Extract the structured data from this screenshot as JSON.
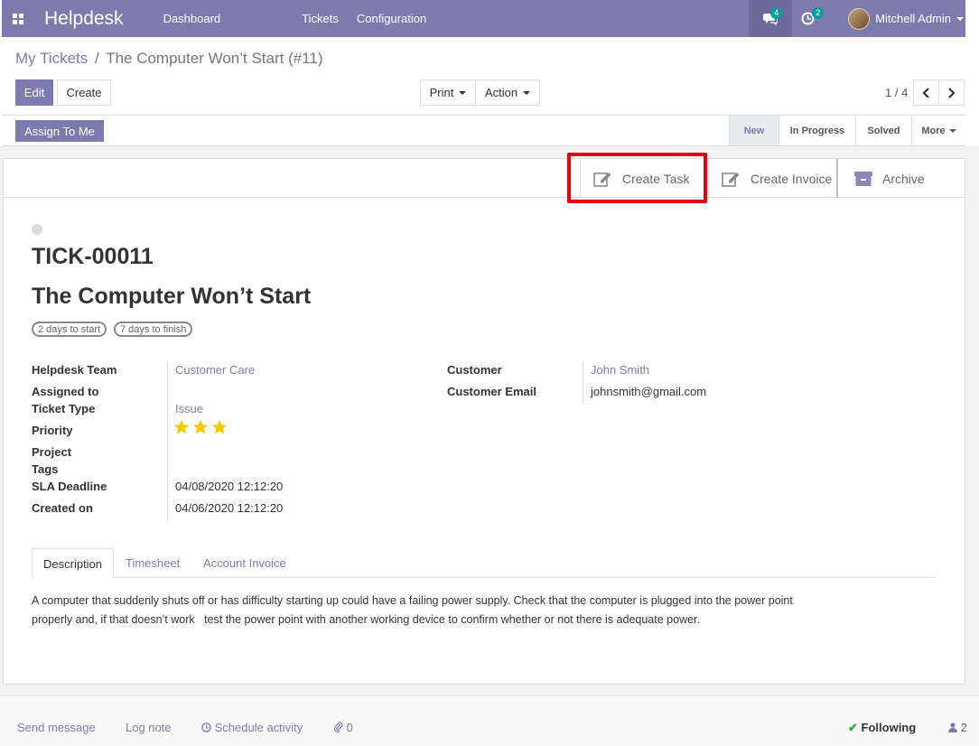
{
  "navbar": {
    "brand": "Helpdesk",
    "menu": [
      "Dashboard",
      "Tickets",
      "Configuration"
    ],
    "messages_count": "4",
    "activities_count": "2",
    "user_name": "Mitchell Admin"
  },
  "breadcrumb": {
    "parent": "My Tickets",
    "separator": "/",
    "current": "The Computer Won’t Start (#11)"
  },
  "actions": {
    "edit": "Edit",
    "create": "Create",
    "print": "Print",
    "action": "Action",
    "pager": "1 / 4"
  },
  "statusbar": {
    "assign": "Assign To Me",
    "stages": [
      "New",
      "In Progress",
      "Solved",
      "More"
    ],
    "current_stage": "New"
  },
  "smart_buttons": {
    "create_task": "Create Task",
    "create_invoice": "Create Invoice",
    "archive": "Archive"
  },
  "ticket": {
    "number": "TICK-00011",
    "title": "The Computer Won’t Start",
    "pills": [
      "2 days to start",
      "7 days to finish"
    ],
    "labels": {
      "team": "Helpdesk Team",
      "assigned": "Assigned to",
      "type": "Ticket Type",
      "priority": "Priority",
      "project": "Project",
      "tags": "Tags",
      "sla": "SLA Deadline",
      "created": "Created on",
      "customer": "Customer",
      "email": "Customer Email"
    },
    "values": {
      "team": "Customer Care",
      "type": "Issue",
      "priority_stars": 3,
      "sla": "04/08/2020 12:12:20",
      "created": "04/06/2020 12:12:20",
      "customer": "John Smith",
      "email": "johnsmith@gmail.com"
    }
  },
  "tabs": [
    "Description",
    "Timesheet",
    "Account Invoice"
  ],
  "description_lines": [
    "A computer that suddenly shuts off or has difficulty starting up could have a failing power supply. Check that the computer is plugged into the power point",
    "properly and, if that doesn’t work   test the power point with another working device to confirm whether or not there is adequate power."
  ],
  "chatter": {
    "send": "Send message",
    "log": "Log note",
    "schedule": "Schedule activity",
    "attachments": "0",
    "following": "Following",
    "followers": "2"
  },
  "colors": {
    "brand": "#7c7bad",
    "highlight": "#e8000e",
    "star": "#f3cc00"
  }
}
